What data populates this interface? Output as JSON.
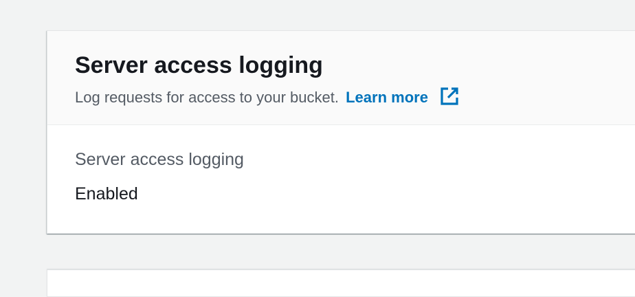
{
  "panel": {
    "title": "Server access logging",
    "description": "Log requests for access to your bucket.",
    "learn_more_label": "Learn more",
    "learn_more_icon": "external-link-icon",
    "link_color": "#0073bb"
  },
  "field": {
    "label": "Server access logging",
    "value": "Enabled"
  }
}
